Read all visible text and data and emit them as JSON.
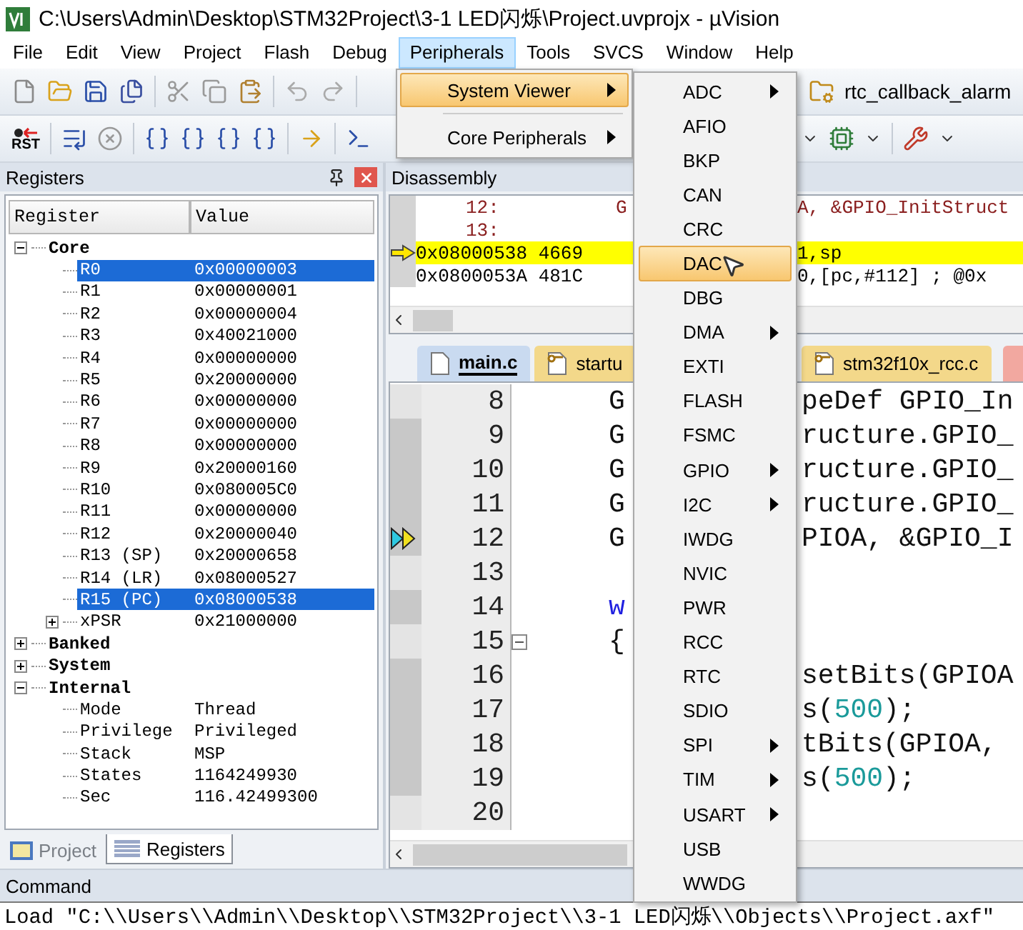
{
  "window": {
    "title": "C:\\Users\\Admin\\Desktop\\STM32Project\\3-1 LED闪烁\\Project.uvprojx - µVision"
  },
  "menus": [
    {
      "label": "File",
      "selected": false
    },
    {
      "label": "Edit",
      "selected": false
    },
    {
      "label": "View",
      "selected": false
    },
    {
      "label": "Project",
      "selected": false
    },
    {
      "label": "Flash",
      "selected": false
    },
    {
      "label": "Debug",
      "selected": false
    },
    {
      "label": "Peripherals",
      "selected": true
    },
    {
      "label": "Tools",
      "selected": false
    },
    {
      "label": "SVCS",
      "selected": false
    },
    {
      "label": "Window",
      "selected": false
    },
    {
      "label": "Help",
      "selected": false
    }
  ],
  "toolbar": {
    "target_function": "rtc_callback_alarm",
    "reset_label": "RST"
  },
  "peripherals_menu": {
    "items": [
      {
        "label": "System Viewer",
        "selected": true,
        "submenu": true
      },
      {
        "label": "Core Peripherals",
        "selected": false,
        "submenu": true
      }
    ]
  },
  "system_viewer": {
    "items": [
      {
        "label": "ADC",
        "selected": false,
        "submenu": true
      },
      {
        "label": "AFIO",
        "selected": false,
        "submenu": false
      },
      {
        "label": "BKP",
        "selected": false,
        "submenu": false
      },
      {
        "label": "CAN",
        "selected": false,
        "submenu": false
      },
      {
        "label": "CRC",
        "selected": false,
        "submenu": false
      },
      {
        "label": "DAC",
        "selected": true,
        "submenu": false
      },
      {
        "label": "DBG",
        "selected": false,
        "submenu": false
      },
      {
        "label": "DMA",
        "selected": false,
        "submenu": true
      },
      {
        "label": "EXTI",
        "selected": false,
        "submenu": false
      },
      {
        "label": "FLASH",
        "selected": false,
        "submenu": false
      },
      {
        "label": "FSMC",
        "selected": false,
        "submenu": false
      },
      {
        "label": "GPIO",
        "selected": false,
        "submenu": true
      },
      {
        "label": "I2C",
        "selected": false,
        "submenu": true
      },
      {
        "label": "IWDG",
        "selected": false,
        "submenu": false
      },
      {
        "label": "NVIC",
        "selected": false,
        "submenu": false
      },
      {
        "label": "PWR",
        "selected": false,
        "submenu": false
      },
      {
        "label": "RCC",
        "selected": false,
        "submenu": false
      },
      {
        "label": "RTC",
        "selected": false,
        "submenu": false
      },
      {
        "label": "SDIO",
        "selected": false,
        "submenu": false
      },
      {
        "label": "SPI",
        "selected": false,
        "submenu": true
      },
      {
        "label": "TIM",
        "selected": false,
        "submenu": true
      },
      {
        "label": "USART",
        "selected": false,
        "submenu": true
      },
      {
        "label": "USB",
        "selected": false,
        "submenu": false
      },
      {
        "label": "WWDG",
        "selected": false,
        "submenu": false
      }
    ]
  },
  "registers": {
    "title": "Registers",
    "columns": [
      "Register",
      "Value"
    ],
    "tree": [
      {
        "name": "Core",
        "expanded": true,
        "children": [
          {
            "name": "R0",
            "value": "0x00000003",
            "selected": true
          },
          {
            "name": "R1",
            "value": "0x00000001",
            "selected": false
          },
          {
            "name": "R2",
            "value": "0x00000004",
            "selected": false
          },
          {
            "name": "R3",
            "value": "0x40021000",
            "selected": false
          },
          {
            "name": "R4",
            "value": "0x00000000",
            "selected": false
          },
          {
            "name": "R5",
            "value": "0x20000000",
            "selected": false
          },
          {
            "name": "R6",
            "value": "0x00000000",
            "selected": false
          },
          {
            "name": "R7",
            "value": "0x00000000",
            "selected": false
          },
          {
            "name": "R8",
            "value": "0x00000000",
            "selected": false
          },
          {
            "name": "R9",
            "value": "0x20000160",
            "selected": false
          },
          {
            "name": "R10",
            "value": "0x080005C0",
            "selected": false
          },
          {
            "name": "R11",
            "value": "0x00000000",
            "selected": false
          },
          {
            "name": "R12",
            "value": "0x20000040",
            "selected": false
          },
          {
            "name": "R13 (SP)",
            "value": "0x20000658",
            "selected": false
          },
          {
            "name": "R14 (LR)",
            "value": "0x08000527",
            "selected": false
          },
          {
            "name": "R15 (PC)",
            "value": "0x08000538",
            "selected": true
          },
          {
            "name": "xPSR",
            "value": "0x21000000",
            "selected": false,
            "expanded": false
          }
        ]
      },
      {
        "name": "Banked",
        "expanded": false
      },
      {
        "name": "System",
        "expanded": false
      },
      {
        "name": "Internal",
        "expanded": true,
        "children": [
          {
            "name": "Mode",
            "value": "Thread",
            "selected": false
          },
          {
            "name": "Privilege",
            "value": "Privileged",
            "selected": false
          },
          {
            "name": "Stack",
            "value": "MSP",
            "selected": false
          },
          {
            "name": "States",
            "value": "1164249930",
            "selected": false
          },
          {
            "name": "Sec",
            "value": "116.42499300",
            "selected": false
          }
        ]
      }
    ]
  },
  "panel_tabs": [
    {
      "label": "Project",
      "selected": false
    },
    {
      "label": "Registers",
      "selected": true
    }
  ],
  "disassembly": {
    "title": "Disassembly",
    "rows": [
      {
        "kind": "source",
        "label": "12:",
        "left": "G",
        "right": "A, &GPIO_InitStruct",
        "current": false
      },
      {
        "kind": "source",
        "label": "13:",
        "current": false
      },
      {
        "kind": "instruction",
        "label": "0x08000538 4669",
        "right": "1,sp",
        "current": true
      },
      {
        "kind": "instruction",
        "label": "0x0800053A 481C",
        "right": "0,[pc,#112]  ; @0x",
        "current": false
      }
    ]
  },
  "editor": {
    "tabs": [
      {
        "label": "main.c",
        "selected": true,
        "kind": "file"
      },
      {
        "label": "startu",
        "selected": false,
        "kind": "key"
      },
      {
        "label": "stm32f10x_rcc.c",
        "selected": false,
        "kind": "key"
      }
    ],
    "lines": [
      {
        "number": "8",
        "covered": false,
        "current": false,
        "left": [
          {
            "t": "G",
            "kind": "plain"
          }
        ],
        "right": [
          {
            "t": "peDef GPIO_In",
            "kind": "plain"
          }
        ]
      },
      {
        "number": "9",
        "covered": true,
        "current": false,
        "left": [
          {
            "t": "G",
            "kind": "plain"
          }
        ],
        "right": [
          {
            "t": "ructure.GPIO_",
            "kind": "plain"
          }
        ]
      },
      {
        "number": "10",
        "covered": true,
        "current": false,
        "left": [
          {
            "t": "G",
            "kind": "plain"
          }
        ],
        "right": [
          {
            "t": "ructure.GPIO_",
            "kind": "plain"
          }
        ]
      },
      {
        "number": "11",
        "covered": true,
        "current": false,
        "left": [
          {
            "t": "G",
            "kind": "plain"
          }
        ],
        "right": [
          {
            "t": "ructure.GPIO_",
            "kind": "plain"
          }
        ]
      },
      {
        "number": "12",
        "covered": true,
        "current": true,
        "left": [
          {
            "t": "G",
            "kind": "plain"
          }
        ],
        "right": [
          {
            "t": "PIOA, &GPIO_I",
            "kind": "plain"
          }
        ]
      },
      {
        "number": "13",
        "covered": false,
        "current": false
      },
      {
        "number": "14",
        "covered": true,
        "current": false,
        "left": [
          {
            "t": "w",
            "kind": "keyword"
          }
        ]
      },
      {
        "number": "15",
        "covered": false,
        "current": false,
        "fold": true,
        "left": [
          {
            "t": "{",
            "kind": "plain"
          }
        ]
      },
      {
        "number": "16",
        "covered": true,
        "current": false,
        "right": [
          {
            "t": "setBits(GPIOA",
            "kind": "plain"
          }
        ]
      },
      {
        "number": "17",
        "covered": true,
        "current": false,
        "right": [
          {
            "t": "s(",
            "kind": "plain"
          },
          {
            "t": "500",
            "kind": "number"
          },
          {
            "t": ");",
            "kind": "plain"
          }
        ]
      },
      {
        "number": "18",
        "covered": true,
        "current": false,
        "right": [
          {
            "t": "tBits(GPIOA,",
            "kind": "plain"
          }
        ]
      },
      {
        "number": "19",
        "covered": true,
        "current": false,
        "right": [
          {
            "t": "s(",
            "kind": "plain"
          },
          {
            "t": "500",
            "kind": "number"
          },
          {
            "t": ");",
            "kind": "plain"
          }
        ]
      },
      {
        "number": "20",
        "covered": false,
        "current": false
      }
    ]
  },
  "command": {
    "title": "Command",
    "text": "Load \"C:\\\\Users\\\\Admin\\\\Desktop\\\\STM32Project\\\\3-1 LED闪烁\\\\Objects\\\\Project.axf\""
  }
}
